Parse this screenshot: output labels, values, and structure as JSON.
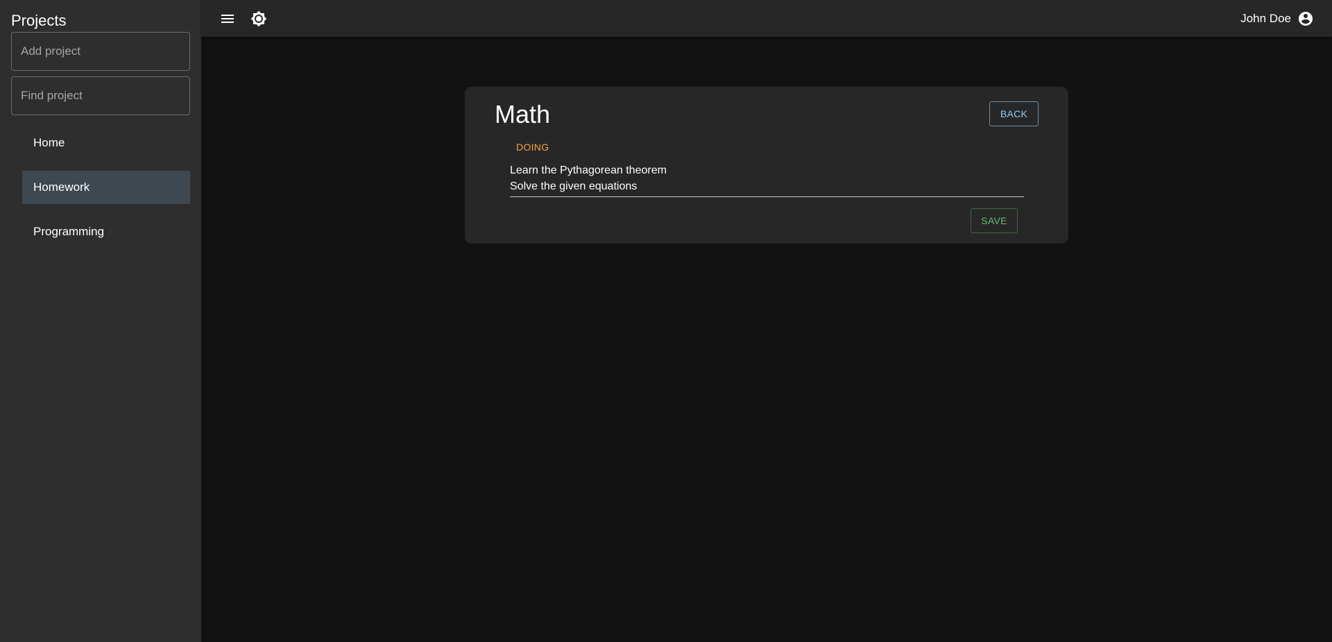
{
  "sidebar": {
    "title": "Projects",
    "add_project": {
      "placeholder": "Add project",
      "value": ""
    },
    "find_project": {
      "placeholder": "Find project",
      "value": ""
    },
    "items": [
      {
        "label": "Home",
        "active": false
      },
      {
        "label": "Homework",
        "active": true
      },
      {
        "label": "Programming",
        "active": false
      }
    ]
  },
  "topbar": {
    "menu_icon": "menu-icon",
    "theme_icon": "brightness-icon",
    "user_name": "John Doe",
    "user_icon": "account-circle-icon"
  },
  "card": {
    "title": "Math",
    "back_label": "BACK",
    "status": "DOING",
    "tasks": [
      "Learn the Pythagorean theorem",
      "Solve the given equations"
    ],
    "save_label": "SAVE"
  },
  "colors": {
    "background": "#121212",
    "sidebar": "#2e2e2e",
    "topbar": "#272727",
    "card": "#272727",
    "active_item": "#3e4851",
    "status": "#f5a243",
    "back_button": "#90caf9",
    "save_button": "#66bb6a"
  }
}
